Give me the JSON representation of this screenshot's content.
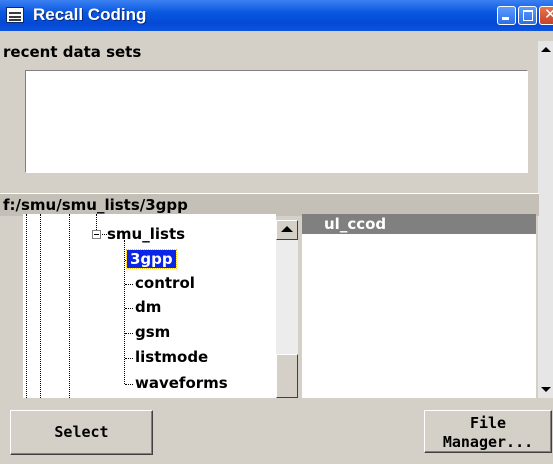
{
  "window": {
    "title": "Recall Coding",
    "icon": "app-window-icon",
    "controls": [
      "minimize-icon",
      "maximize-icon",
      "close-icon"
    ],
    "accent": "#0a58e0"
  },
  "recent": {
    "label": "recent data sets",
    "items": []
  },
  "browser": {
    "path": "f:/smu/smu_lists/3gpp",
    "tree": {
      "parent": "smu_lists",
      "children": [
        "3gpp",
        "control",
        "dm",
        "gsm",
        "listmode",
        "waveforms"
      ],
      "selected": "3gpp"
    },
    "files": [
      "ul_ccod"
    ],
    "selection_color": "#0a24e8"
  },
  "buttons": {
    "select": "Select",
    "file_manager": "File\nManager..."
  }
}
